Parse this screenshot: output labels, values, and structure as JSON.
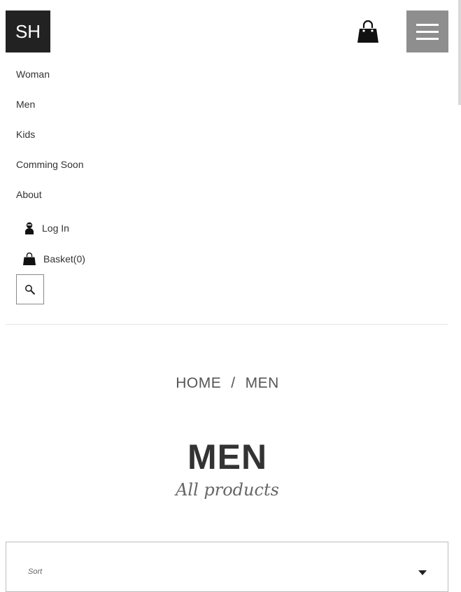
{
  "header": {
    "logo_text": "SH",
    "cart_icon": "shopping-bag-icon",
    "menu_icon": "hamburger-menu-icon",
    "menu_button_color": "#8e8e8e"
  },
  "nav": {
    "items": [
      {
        "label": "Woman"
      },
      {
        "label": "Men"
      },
      {
        "label": "Kids"
      },
      {
        "label": "Comming Soon"
      },
      {
        "label": "About"
      }
    ],
    "login_label": "Log In",
    "login_icon": "user-icon",
    "basket_label": "Basket(0)",
    "basket_icon": "shopping-bag-icon",
    "search_icon": "search-icon"
  },
  "breadcrumb": {
    "items": [
      "HOME",
      "MEN"
    ],
    "separator": "/"
  },
  "page": {
    "title": "MEN",
    "subtitle": "All products"
  },
  "sort": {
    "label": "Sort",
    "icon": "caret-down-icon"
  }
}
